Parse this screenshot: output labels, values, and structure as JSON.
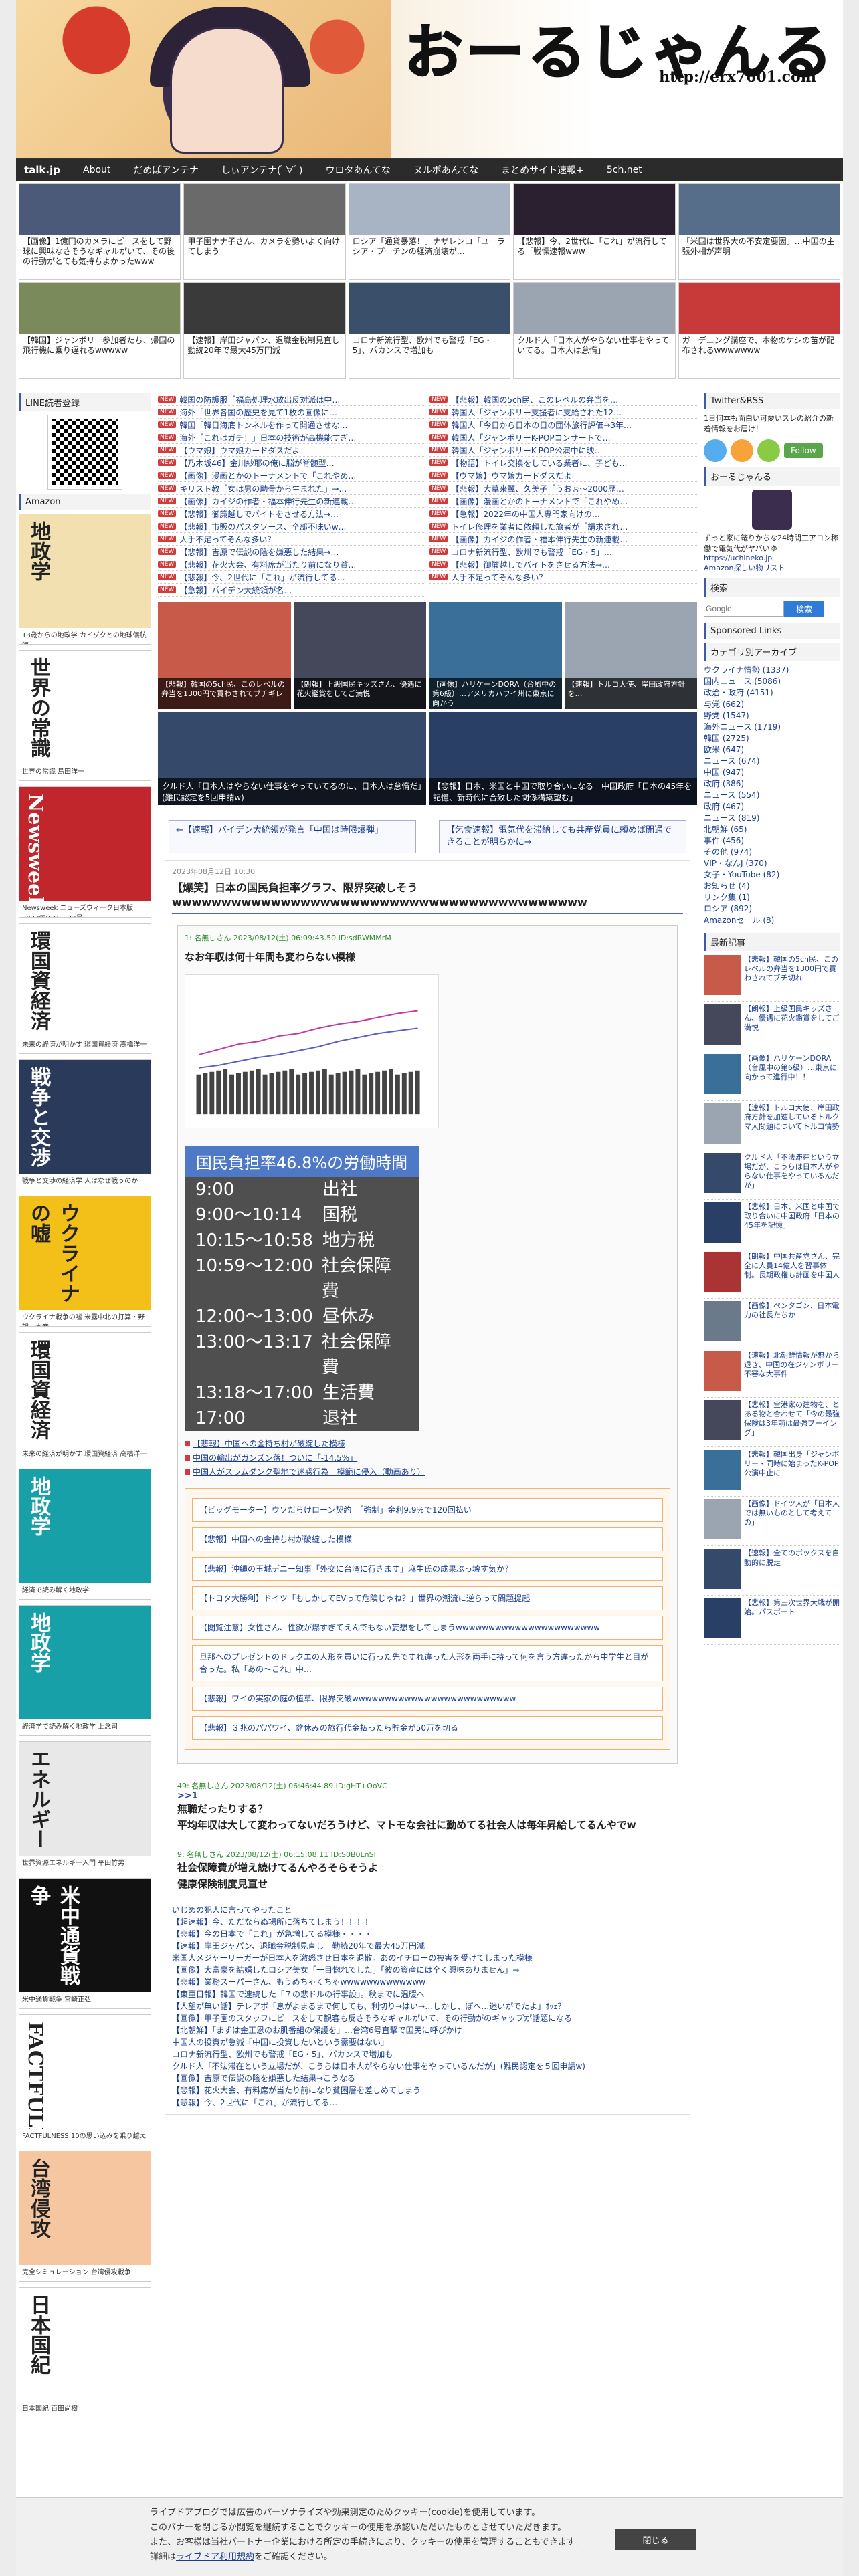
{
  "header": {
    "logo_text": "おーるじゃんる",
    "url": "http://erx7601.com"
  },
  "nav": [
    "talk.jp",
    "About",
    "だめぽアンテナ",
    "しぃアンテナ(ﾟ∀ﾟ)",
    "ウロタあんてな",
    "ヌルポあんてな",
    "まとめサイト速報+",
    "5ch.net"
  ],
  "top_thumbs": [
    {
      "cap": "【画像】1億円のカメラにピースをして野球に興味なさそうなギャルがいて、その後の行動がとても気持ちよかったwww",
      "color": "#4a5a78"
    },
    {
      "cap": "甲子園ナナ子さん、カメラを勢いよく向けてしまう",
      "color": "#6a6a6a"
    },
    {
      "cap": "ロシア「通貨暴落！」ナザレンコ「ユーラシア・プーチンの経済崩壊が…",
      "color": "#a8b4c4"
    },
    {
      "cap": "【悲報】今、2世代に「これ」が流行してる「戦慄速報www",
      "color": "#2a2030"
    },
    {
      "cap": "「米国は世界大の不安定要因」…中国の主張外相が声明",
      "color": "#566e8a"
    },
    {
      "cap": "【韓国】ジャンボリー参加者たち、帰国の飛行機に乗り遅れるwwwww",
      "color": "#7a8a5a"
    },
    {
      "cap": "【速報】岸田ジャパン、退職金税制見直し 勤続20年で最大45万円減",
      "color": "#3a3a3a"
    },
    {
      "cap": "コロナ新流行型、欧州でも警戒「EG・5」、パカンスで増加も",
      "color": "#3a4f6a"
    },
    {
      "cap": "クルド人「日本人がやらない仕事をやっていてる。日本人は怠惰」",
      "color": "#9aa5b1"
    },
    {
      "cap": "ガーデニング講座で、本物のケシの苗が配布されるwwwwwww",
      "color": "#c83a3a"
    }
  ],
  "left": {
    "line_title": "LINE読者登録",
    "amazon_title": "Amazon",
    "books": [
      {
        "title": "地政学",
        "foot": "13歳からの地政学 カイゾクとの地球儀航海"
      },
      {
        "title": "世界の常識",
        "foot": "世界の常識 島田洋一"
      },
      {
        "title": "Newsweek",
        "foot": "Newsweek ニューズウィーク日本版 2023年8/15・22号"
      },
      {
        "title": "環国資経済",
        "foot": "未来の経済が明かす 環国資経済 高橋洋一"
      },
      {
        "title": "戦争と交渉",
        "foot": "戦争と交渉の経済学 人はなぜ戦うのか"
      },
      {
        "title": "ウクライナの嘘",
        "foot": "ウクライナ戦争の嘘 米露中北の打算・野望・本音"
      },
      {
        "title": "環国資経済",
        "foot": "未来の経済が明かす 環国資経済 高橋洋一"
      },
      {
        "title": "地政学",
        "foot": "経済で読み解く地政学"
      },
      {
        "title": "地政学",
        "foot": "経済学で読み解く地政学 上念司"
      },
      {
        "title": "エネルギー",
        "foot": "世界資源エネルギー入門 平田竹男"
      },
      {
        "title": "米中通貨戦争",
        "foot": "米中通貨戦争 宮崎正弘"
      },
      {
        "title": "FACTFULNESS",
        "foot": "FACTFULNESS 10の思い込みを乗り越え"
      },
      {
        "title": "台湾侵攻",
        "foot": "完全シミュレーション 台湾侵攻戦争"
      },
      {
        "title": "日本国紀",
        "foot": "日本国紀 百田尚樹"
      }
    ]
  },
  "lists": {
    "left": [
      "韓国の防護服「福島処理水放出反対派は中…",
      "海外「世界各国の歴史を見て1枚の画像に…",
      "韓国「韓日海底トンネルを作って開通させな…",
      "海外「これはガチ！」日本の技術が高機能すぎ…",
      "【ウマ娘】ウマ娘カードダスだよ",
      "【乃木坂46】金川紗耶の俺に脳が脊髄型…",
      "【画像】漫画とかのトーナメントで「これやめ…",
      "キリスト教「女は男の助骨から生まれた」→…",
      "【画像】カイジの作者・福本伸行先生の新連載…",
      "【悲報】御簾越しでバイトをさせる方法→…",
      "【悲報】市販のパスタソース、全部不味いw…",
      "人手不足ってそんな多い？",
      "【悲報】吉原で伝説の陰を嫌悪した結果→…",
      "【悲報】花火大会、有料席が当たり前になり貧…",
      "【悲報】今、2世代に「これ」が流行してる…",
      "【急報】パイデン大統領が名…"
    ],
    "right": [
      "【悲報】韓国の5ch民、このレベルの弁当を…",
      "韓国人「ジャンボリー支援者に支給された12…",
      "韓国人「今日から日本の日の団体旅行評価→3年…",
      "韓国人「ジャンボリーK-POPコンサートで…",
      "韓国人「ジャンボリーK-POP公演中に映…",
      "【物語】トイレ交換をしている業者に、子ども…",
      "【ウマ娘】ウマ娘カードダスだよ",
      "【悲報】大草来翼、久美子「うおぉ〜2000歴…",
      "【画像】漫画とかのトーナメントで「これやめ…",
      "【急報】2022年の中国人専門家向けの…",
      "トイレ修理を業者に依頼した旅者が「請求され…",
      "【画像】カイジの作者・福本伸行先生の新連載…",
      "コロナ新流行型、欧州でも警戒「EG・5」…",
      "【悲報】御簾越しでバイトをさせる方法→…",
      "人手不足ってそんな多い？"
    ]
  },
  "big_thumbs": [
    {
      "cap": "【悲報】韓国の5ch民、このレベルの弁当を1300円で買わされてブチギレ",
      "color": "#c85a4a"
    },
    {
      "cap": "【朗報】上級国民キッズさん、優遇に花火鑑賞をしてご満悦",
      "color": "#44485a"
    },
    {
      "cap": "【画像】ハリケーンDORA（台風中の第6級）…アメリカハワイ州に東京に向かう",
      "color": "#3a6f9a"
    },
    {
      "cap": "【速報】トルコ大使、岸田政府方針を…",
      "color": "#9aa5b1"
    },
    {
      "cap": "クルド人「日本人はやらない仕事をやっていてるのに、日本人は怠惰だ」(難民認定を5回申請w)",
      "color": "#354a6a"
    },
    {
      "cap": "【悲報】日本、米国と中国で取り合いになる　中国政府「日本の45年を記憶、新時代に合致した関係構築望む」",
      "color": "#2a3f66"
    }
  ],
  "pager": {
    "prev": "←【速報】バイデン大統領が発言「中国は時限爆弾」",
    "next": "【乞食速報】電気代を滞納しても共産党員に頼めば開通できることが明らかに→"
  },
  "article": {
    "date": "2023年08月12日 10:30",
    "title": "【爆笑】日本の国民負担率グラフ、限界突破しそうwwwwwwwwwwwwwwwwwwwwwwwwwwwwwwwwwwwwwwwwww",
    "res1_name": "1: 名無しさん 2023/08/12(土) 06:09:43.50 ID:sdRWMMrM",
    "res1_body": "なお年収は何十年間も変わらない模様",
    "table_title_pre": "国民負担率",
    "table_title_num": "46.8%",
    "table_title_post": "の労働時間",
    "table_rows": [
      [
        "9:00",
        "出社"
      ],
      [
        "9:00〜10:14",
        "国税"
      ],
      [
        "10:15〜10:58",
        "地方税"
      ],
      [
        "10:59〜12:00",
        "社会保障費"
      ],
      [
        "12:00〜13:00",
        "昼休み"
      ],
      [
        "13:00〜13:17",
        "社会保障費"
      ],
      [
        "13:18〜17:00",
        "生活費"
      ],
      [
        "17:00",
        "退社"
      ]
    ],
    "red_links": [
      "【悲報】中国への金持ち村が破綻した模様",
      "中国の輸出がガンズン落！ついに「-14.5%」",
      "中国人がスラムダンク聖地で迷惑行為　模範に侵入（動画あり）"
    ],
    "related": [
      "【ビッグモーター】ウソだらけローン契約　「強制」金利9.9%で120回払い",
      "【悲報】中国への金持ち村が破綻した模様",
      "【悲報】沖縄の玉城デニー知事「外交に台湾に行きます」麻生氏の成果ぶっ壊す気か？",
      "【トヨタ大勝利】ドイツ「もしかしてEVって危険じゃね？」世界の潮流に逆らって問題提起",
      "【閲覧注意】女性さん、性欲が爆すぎてえんでもない妄想をしてしまうwwwwwwwwwwwwwwwwwwwwww",
      "旦那へのプレゼントのドラクエの人形を買いに行った先ですれ違った人形を両手に持って何を言う方違ったから中学生と目が合った。私「あの〜これ」中…",
      "【悲報】ワイの実家の庭の植草、限界突破wwwwwwwwwwwwwwwwwwwwwwwww",
      "【悲報】３兆のパパワイ、盆休みの旅行代金払ったら貯金が50万を切る"
    ],
    "res2_name": "49: 名無しさん 2023/08/12(土) 06:46:44.89 ID:gHT+OoVC",
    "res2_anchor": ">>1",
    "res2_body1": "無職だったりする？",
    "res2_body2": "平均年収は大して変わってないだろうけど、マトモな会社に勤めてる社会人は毎年昇給してるんやでw",
    "res3_name": "9: 名無しさん 2023/08/12(土) 06:15:08.11 ID:S0B0LnSI",
    "res3_body1": "社会保障費が増え続けてるんやろそらそうよ",
    "res3_body2": "健康保険制度見直せ",
    "sublist": [
      "いじめの犯人に言ってやったこと",
      "【超速報】今、ただならぬ場所に落ちてしまう！！！！",
      "【悲報】今の日本で「これ」が急増してる模様・・・・",
      "【速報】岸田ジャパン、退職金税制見直し　勤続20年で最大45万円減",
      "米国人メジャーリーガーが日本人を激怒させ日本を退散。あのイチローの被害を受けてしまった模様",
      "【画像】大富豪を結婚したロシア美女「一目惚れでした」「彼の資産には全く興味ありません」→",
      "【悲報】業務スーパーさん、もうめちゃくちゃwwwwwwwwwwwww",
      "【東亜日報】韓国で連続した「７の悲ドルの行事設」。秋までに温暖へ",
      "【人望が無い話】テレアポ「息がよまるまで何しても、利切り→はい→…しかし、ぽへ…迷いがでたよ」ｵｯｪ？",
      "【画像】甲子園のスタッフにピースをして観客も反さそうなギャルがいて、その行動がのギャップが話題になる",
      "【北朝鮮】「まずは金正恩のお肌番組の保護を」…台湾6号直撃で国民に呼びかけ",
      "中国人の投資が急減「中国に投資したいという需要はない」",
      "コロナ新流行型、欧州でも警戒「EG・5」、バカンスで増加も",
      "クルド人「不法滞在という立場だが、こうらは日本人がやらない仕事をやっているんだが」(難民認定を５回申請w)",
      "【画像】吉原で伝説の陰を嫌悪した結果→こうなる",
      "【悲報】花火大会、有料席が当たり前になり貧困層を差しめてしまう",
      "【悲報】今、2世代に「これ」が流行してる…"
    ]
  },
  "right": {
    "twitter_title": "Twitter&RSS",
    "twitter_text": "1日何本も面白い可愛いスレの紹介の新着情報をお届け！",
    "follow_label": "Follow",
    "profile_title": "おーるじゃんる",
    "profile_text": "ずっと家に篭りかちな24時間工アコン稼働で電気代がヤバいゆ",
    "profile_link": "https://uchineko.jp",
    "profile_amazon": "Amazon探しい物リスト",
    "search_title": "検索",
    "search_placeholder": "Google",
    "search_button": "検索",
    "sponsored": "Sponsored Links",
    "category_title": "カテゴリ別アーカイブ",
    "categories": [
      "ウクライナ情勢 (1337)",
      "国内ニュース (5086)",
      "政治・政府 (4151)",
      "与党 (662)",
      "野党 (1547)",
      "海外ニュース (1719)",
      "韓国 (2725)",
      "欧米 (647)",
      "ニュース (674)",
      "中国 (947)",
      "政府 (386)",
      "ニュース (554)",
      "政府 (467)",
      "ニュース (819)",
      "北朝鮮 (65)",
      "事件 (456)",
      "その他 (974)",
      "VIP・なんJ (370)",
      "女子・YouTube (82)",
      "お知らせ (4)",
      "リンク集 (1)",
      "ロシア (892)",
      "Amazonセール (8)"
    ],
    "new_title": "最新記事",
    "new_items": [
      "【悲報】韓国の5ch民、このレベルの弁当を1300円で買わされてブチ切れ",
      "【朗報】上級国民キッズさん、優遇に花火鑑賞をしてご満悦",
      "【画像】ハリケーンDORA（台風中の第6級）…東京に向かって進行中！！",
      "【速報】トルコ大使、岸田政府方針を加速しているトルクマ人問題についてトルコ情勢",
      "クルド人「不法滞在という立場だが、こうらは日本人がやらない仕事をやっているんだが」",
      "【悲報】日本、米国と中国で取り合いに中国政府「日本の45年を記憶」",
      "【朗報】中国共産党さん、完全に人員14億人を習事体制。長期政権も計画を中国人",
      "【画像】ペンタゴン、日本電力の社長たちか",
      "【速報】北朝鮮情報が無から退き、中国の在ジャンボリー不審な大事件",
      "【悲報】空港家の建物を、とある物と合わせて「今の最強保険は3年前は最強ブーイング」",
      "【悲報】韓国出身「ジャンボリー・同時に始まったK-POP公演中止に",
      "【画像】ドイツ人が「日本人では無いものとして考えての」",
      "【速報】全てのボックスを自動的に脱走",
      "【悲報】第三次世界大戦が開始。パスポート"
    ]
  },
  "cookie": {
    "line1": "ライブドアブログでは広告のパーソナライズや効果測定のためクッキー(cookie)を使用しています。",
    "line2": "このバナーを閉じるか閲覧を継続することでクッキーの使用を承認いただいたものとさせていただきます。",
    "line3": "また、お客様は当社パートナー企業における所定の手続きにより、クッキーの使用を管理することもできます。",
    "line4_pre": "詳細は",
    "line4_link": "ライブドア利用規約",
    "line4_post": "をご確認ください。",
    "close": "閉じる"
  }
}
